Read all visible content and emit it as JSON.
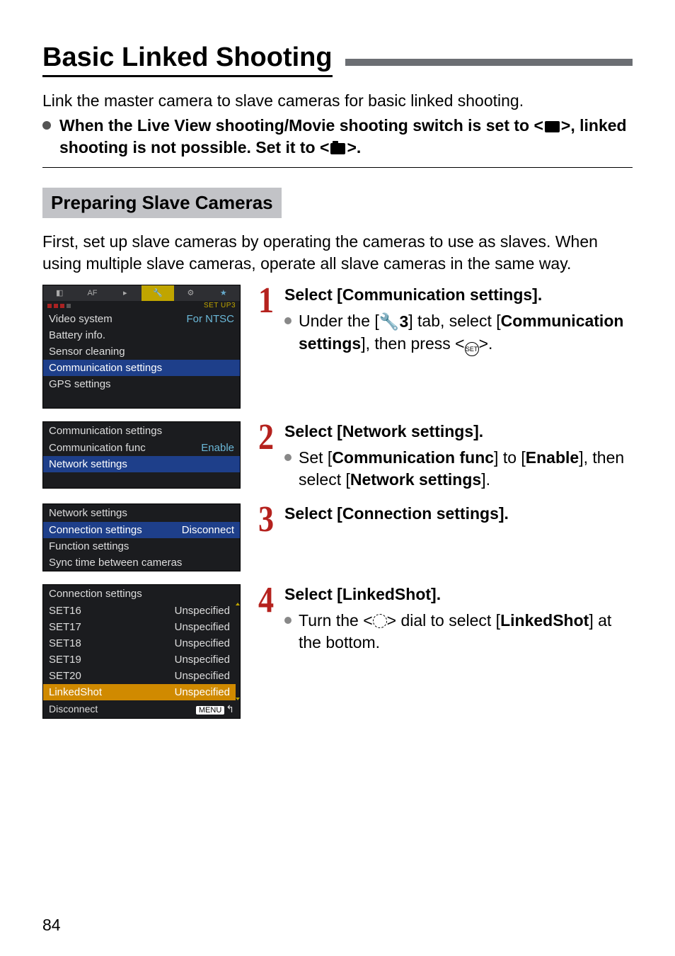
{
  "page": {
    "title": "Basic Linked Shooting",
    "intro": "Link the master camera to slave cameras for basic linked shooting.",
    "note_pre": "When the Live View shooting/Movie shooting switch is set to <",
    "note_mid": ">, linked shooting is not possible. Set it to <",
    "note_post": ">.",
    "section_header": "Preparing Slave Cameras",
    "section_intro": "First, set up slave cameras by operating the cameras to use as slaves. When using multiple slave cameras, operate all slave cameras in the same way.",
    "page_number": "84"
  },
  "steps": [
    {
      "num": "1",
      "title": "Select [Communication settings].",
      "body_pre": "Under the [",
      "tab_label": "3",
      "body_mid": "] tab, select [",
      "body_bold": "Communication settings",
      "body_post": "], then press <",
      "set_label": "SET",
      "body_end": ">."
    },
    {
      "num": "2",
      "title": "Select [Network settings].",
      "body_pre": "Set [",
      "body_b1": "Communication func",
      "body_mid": "] to [",
      "body_b2": "Enable",
      "body_mid2": "], then select [",
      "body_b3": "Network settings",
      "body_post": "]."
    },
    {
      "num": "3",
      "title": "Select [Connection settings]."
    },
    {
      "num": "4",
      "title": "Select [LinkedShot].",
      "body_pre": "Turn the <",
      "body_mid": "> dial to select [",
      "body_bold": "LinkedShot",
      "body_post": "] at the bottom."
    }
  ],
  "menu1": {
    "setup_label": "SET UP3",
    "items": [
      {
        "label": "Video system",
        "val": "For NTSC"
      },
      {
        "label": "Battery info."
      },
      {
        "label": "Sensor cleaning"
      },
      {
        "label": "Communication settings",
        "hl": true
      },
      {
        "label": "GPS settings"
      }
    ],
    "tabs": [
      "📷",
      "AF",
      "▶",
      "🔧",
      "🔧",
      "★"
    ]
  },
  "menu2": {
    "title": "Communication settings",
    "items": [
      {
        "label": "Communication func",
        "val": "Enable"
      },
      {
        "label": "Network settings",
        "hl": true
      }
    ]
  },
  "menu3": {
    "title": "Network settings",
    "items": [
      {
        "label": "Connection settings",
        "val": "Disconnect",
        "hl": true
      },
      {
        "label": "Function settings"
      },
      {
        "label": "Sync time between cameras"
      }
    ]
  },
  "menu4": {
    "title": "Connection settings",
    "items": [
      {
        "label": "SET16",
        "val": "Unspecified"
      },
      {
        "label": "SET17",
        "val": "Unspecified"
      },
      {
        "label": "SET18",
        "val": "Unspecified"
      },
      {
        "label": "SET19",
        "val": "Unspecified"
      },
      {
        "label": "SET20",
        "val": "Unspecified"
      },
      {
        "label": "LinkedShot",
        "val": "Unspecified",
        "hl": true
      }
    ],
    "footer_left": "Disconnect",
    "footer_btn": "MENU",
    "footer_icon": "↰"
  }
}
